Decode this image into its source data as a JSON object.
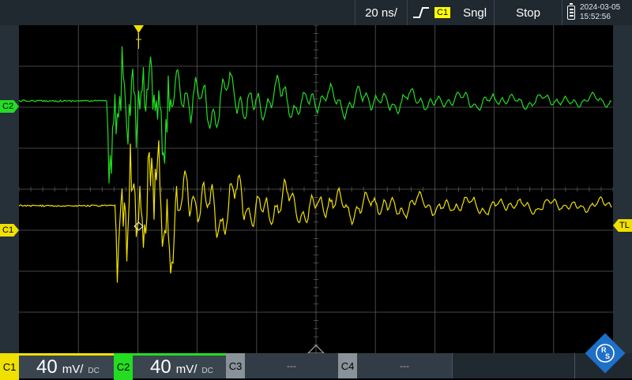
{
  "topbar": {
    "timebase": "20 ns/",
    "trigger_source": "C1",
    "trigger_mode": "Sngl",
    "run_state": "Stop",
    "date": "2024-03-05",
    "time": "15:52:56"
  },
  "markers": {
    "c2": "C2",
    "c1": "C1",
    "trigger_level": "TL"
  },
  "channels": [
    {
      "label": "C1",
      "value": "40",
      "unit": "mV/",
      "coupling": "DC",
      "color": "#f0e000"
    },
    {
      "label": "C2",
      "value": "40",
      "unit": "mV/",
      "coupling": "DC",
      "color": "#22dd22"
    },
    {
      "label": "C3",
      "off_text": "---"
    },
    {
      "label": "C4",
      "off_text": "---"
    }
  ],
  "colors": {
    "c1_trace": "#f0e000",
    "c2_trace": "#22dd22",
    "grid": "#5a5a5a",
    "trigger": "#f0e000"
  },
  "icons": [
    "trigger-rising-edge-icon",
    "battery-icon",
    "rs-logo-icon",
    "trigger-position-icon",
    "trigger-level-icon"
  ]
}
